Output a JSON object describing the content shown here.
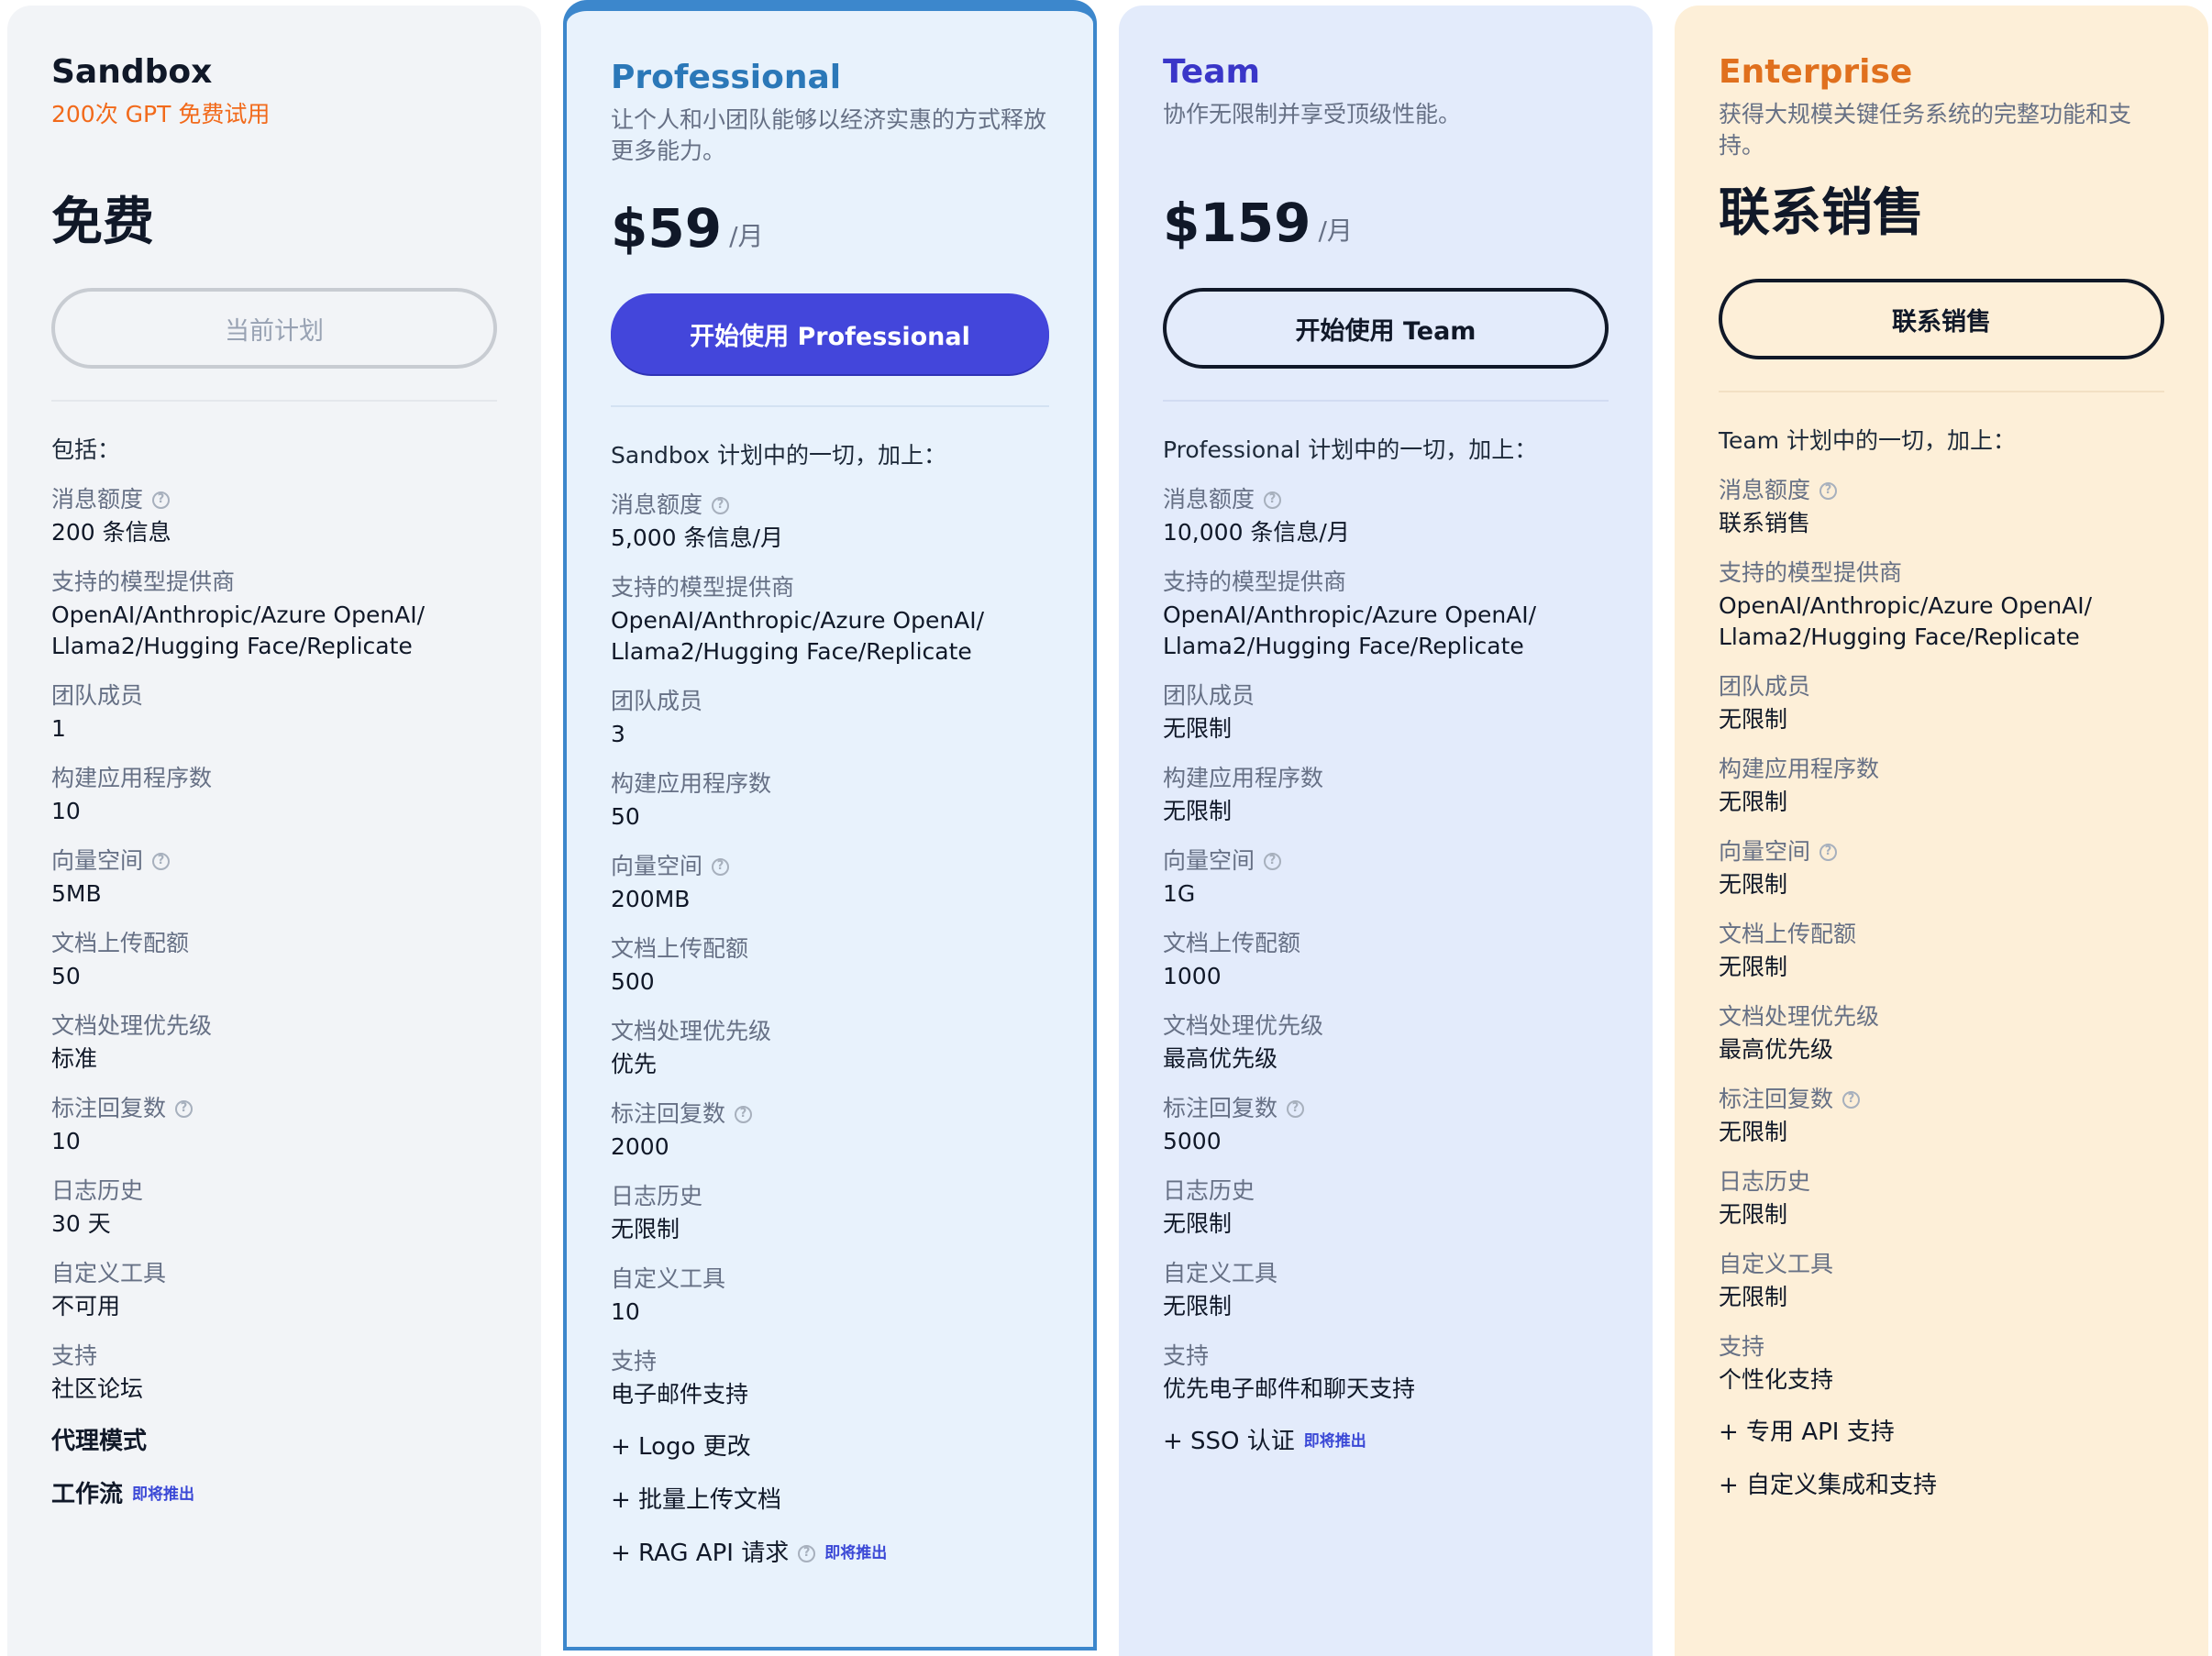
{
  "plans": [
    {
      "name": "Sandbox",
      "subtitle": "200次 GPT 免费试用",
      "price_label": "免费",
      "cta": "当前计划",
      "includes": "包括：",
      "features": [
        {
          "label": "消息额度",
          "value": "200 条信息",
          "help": "?"
        },
        {
          "label": "支持的模型提供商",
          "value": "OpenAI/Anthropic/Azure OpenAI/ Llama2/Hugging Face/Replicate"
        },
        {
          "label": "团队成员",
          "value": "1"
        },
        {
          "label": "构建应用程序数",
          "value": "10"
        },
        {
          "label": "向量空间",
          "value": "5MB",
          "help": "?"
        },
        {
          "label": "文档上传配额",
          "value": "50"
        },
        {
          "label": "文档处理优先级",
          "value": "标准"
        },
        {
          "label": "标注回复数",
          "value": "10",
          "help": "?"
        },
        {
          "label": "日志历史",
          "value": "30 天"
        },
        {
          "label": "自定义工具",
          "value": "不可用"
        },
        {
          "label": "支持",
          "value": "社区论坛"
        }
      ],
      "extras": [
        {
          "text": "代理模式"
        },
        {
          "text": "工作流",
          "soon": "即将推出"
        }
      ]
    },
    {
      "name": "Professional",
      "subtitle": "让个人和小团队能够以经济实惠的方式释放更多能力。",
      "price": "$59",
      "unit": "/月",
      "cta": "开始使用 Professional",
      "includes": "Sandbox 计划中的一切，加上：",
      "features": [
        {
          "label": "消息额度",
          "value": "5,000 条信息/月",
          "help": "?"
        },
        {
          "label": "支持的模型提供商",
          "value": "OpenAI/Anthropic/Azure OpenAI/ Llama2/Hugging Face/Replicate"
        },
        {
          "label": "团队成员",
          "value": "3"
        },
        {
          "label": "构建应用程序数",
          "value": "50"
        },
        {
          "label": "向量空间",
          "value": "200MB",
          "help": "?"
        },
        {
          "label": "文档上传配额",
          "value": "500"
        },
        {
          "label": "文档处理优先级",
          "value": "优先"
        },
        {
          "label": "标注回复数",
          "value": "2000",
          "help": "?"
        },
        {
          "label": "日志历史",
          "value": "无限制"
        },
        {
          "label": "自定义工具",
          "value": "10"
        },
        {
          "label": "支持",
          "value": "电子邮件支持"
        }
      ],
      "extras": [
        {
          "text": "+ Logo 更改"
        },
        {
          "text": "+ 批量上传文档"
        },
        {
          "text": "+ RAG API 请求",
          "help": "?",
          "soon": "即将推出"
        }
      ]
    },
    {
      "name": "Team",
      "subtitle": "协作无限制并享受顶级性能。",
      "price": "$159",
      "unit": "/月",
      "cta": "开始使用 Team",
      "includes": "Professional 计划中的一切，加上：",
      "features": [
        {
          "label": "消息额度",
          "value": "10,000 条信息/月",
          "help": "?"
        },
        {
          "label": "支持的模型提供商",
          "value": "OpenAI/Anthropic/Azure OpenAI/ Llama2/Hugging Face/Replicate"
        },
        {
          "label": "团队成员",
          "value": "无限制"
        },
        {
          "label": "构建应用程序数",
          "value": "无限制"
        },
        {
          "label": "向量空间",
          "value": "1G",
          "help": "?"
        },
        {
          "label": "文档上传配额",
          "value": "1000"
        },
        {
          "label": "文档处理优先级",
          "value": "最高优先级"
        },
        {
          "label": "标注回复数",
          "value": "5000",
          "help": "?"
        },
        {
          "label": "日志历史",
          "value": "无限制"
        },
        {
          "label": "自定义工具",
          "value": "无限制"
        },
        {
          "label": "支持",
          "value": "优先电子邮件和聊天支持"
        }
      ],
      "extras": [
        {
          "text": "+ SSO 认证",
          "soon": "即将推出"
        }
      ]
    },
    {
      "name": "Enterprise",
      "subtitle": "获得大规模关键任务系统的完整功能和支持。",
      "price_label": "联系销售",
      "cta": "联系销售",
      "includes": "Team 计划中的一切，加上：",
      "features": [
        {
          "label": "消息额度",
          "value": "联系销售",
          "help": "?"
        },
        {
          "label": "支持的模型提供商",
          "value": "OpenAI/Anthropic/Azure OpenAI/ Llama2/Hugging Face/Replicate"
        },
        {
          "label": "团队成员",
          "value": "无限制"
        },
        {
          "label": "构建应用程序数",
          "value": "无限制"
        },
        {
          "label": "向量空间",
          "value": "无限制",
          "help": "?"
        },
        {
          "label": "文档上传配额",
          "value": "无限制"
        },
        {
          "label": "文档处理优先级",
          "value": "最高优先级"
        },
        {
          "label": "标注回复数",
          "value": "无限制",
          "help": "?"
        },
        {
          "label": "日志历史",
          "value": "无限制"
        },
        {
          "label": "自定义工具",
          "value": "无限制"
        },
        {
          "label": "支持",
          "value": "个性化支持"
        }
      ],
      "extras": [
        {
          "text": "+ 专用 API 支持"
        },
        {
          "text": "+ 自定义集成和支持"
        }
      ]
    }
  ]
}
